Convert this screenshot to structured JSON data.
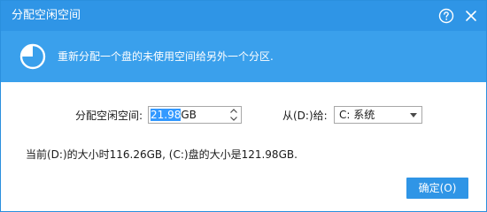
{
  "window": {
    "title": "分配空闲空间"
  },
  "banner": {
    "icon": "pie-chart-icon",
    "text": "重新分配一个盘的未使用空间给另外一个分区."
  },
  "form": {
    "size_label": "分配空闲空间:",
    "size_value_selected": "21.98",
    "size_unit": "GB",
    "from_label": "从(D:)给:",
    "target_value": "C: 系统"
  },
  "info": {
    "text": "当前(D:)的大小时116.26GB, (C:)盘的大小是121.98GB."
  },
  "buttons": {
    "ok_label": "确定(O)"
  },
  "colors": {
    "titlebar": "#2f95e6",
    "banner": "#3aa0ec",
    "button": "#2f95e6",
    "selection": "#3399ff"
  }
}
